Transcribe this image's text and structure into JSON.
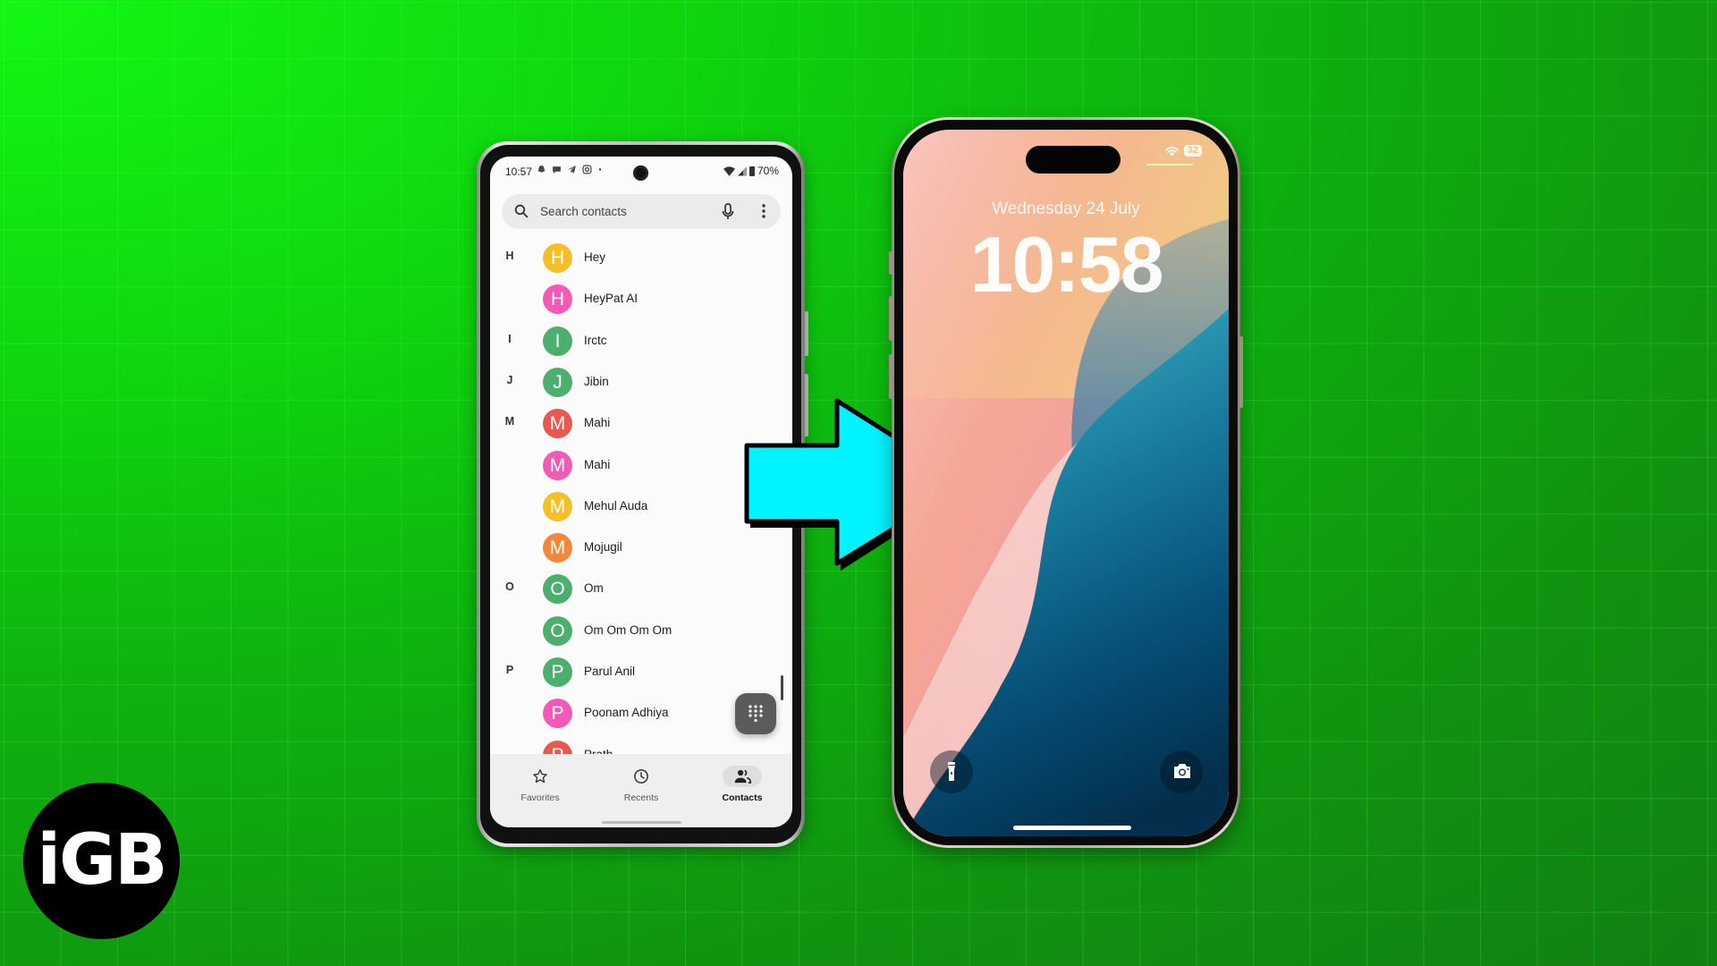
{
  "android": {
    "status": {
      "time": "10:57",
      "battery": "70%"
    },
    "search": {
      "placeholder": "Search contacts"
    },
    "contacts": [
      {
        "section": "H",
        "initial": "H",
        "name": "Hey",
        "color": "#f6bf26"
      },
      {
        "section": "",
        "initial": "H",
        "name": "HeyPat AI",
        "color": "#f25ab5"
      },
      {
        "section": "I",
        "initial": "I",
        "name": "Irctc",
        "color": "#4caf6e"
      },
      {
        "section": "J",
        "initial": "J",
        "name": "Jibin",
        "color": "#4caf6e"
      },
      {
        "section": "M",
        "initial": "M",
        "name": "Mahi",
        "color": "#e8584f"
      },
      {
        "section": "",
        "initial": "M",
        "name": "Mahi",
        "color": "#f25ab5"
      },
      {
        "section": "",
        "initial": "M",
        "name": "Mehul Auda",
        "color": "#f6bf26"
      },
      {
        "section": "",
        "initial": "M",
        "name": "Mojugil",
        "color": "#f4883a"
      },
      {
        "section": "O",
        "initial": "O",
        "name": "Om",
        "color": "#4caf6e"
      },
      {
        "section": "",
        "initial": "O",
        "name": "Om Om Om Om",
        "color": "#4caf6e"
      },
      {
        "section": "P",
        "initial": "P",
        "name": "Parul Anil",
        "color": "#4caf6e"
      },
      {
        "section": "",
        "initial": "P",
        "name": "Poonam Adhiya",
        "color": "#f25ab5"
      },
      {
        "section": "",
        "initial": "P",
        "name": "Prath...",
        "color": "#e8584f"
      }
    ],
    "nav": [
      {
        "label": "Favorites",
        "icon": "star-icon",
        "active": false
      },
      {
        "label": "Recents",
        "icon": "clock-icon",
        "active": false
      },
      {
        "label": "Contacts",
        "icon": "people-icon",
        "active": true
      }
    ]
  },
  "iphone": {
    "battery": "32",
    "date": "Wednesday 24 July",
    "time": "10:58"
  },
  "logo": {
    "text": "iGB"
  },
  "colors": {
    "arrow": "#00f4ff",
    "background": "#10d010"
  }
}
